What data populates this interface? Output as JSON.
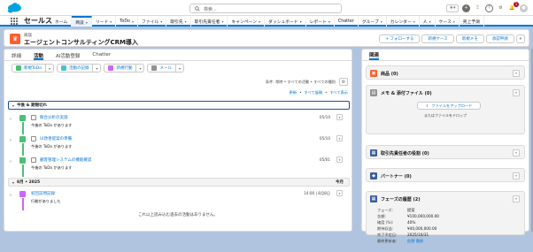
{
  "topbar": {
    "search_placeholder": "検索...",
    "notification_count": "1"
  },
  "nav": {
    "app_name": "セールス",
    "items": [
      {
        "label": "ホーム",
        "has_menu": false,
        "active": false
      },
      {
        "label": "商談",
        "has_menu": true,
        "active": true
      },
      {
        "label": "リード",
        "has_menu": true,
        "active": false
      },
      {
        "label": "ToDo",
        "has_menu": true,
        "active": false
      },
      {
        "label": "ファイル",
        "has_menu": true,
        "active": false
      },
      {
        "label": "取引先",
        "has_menu": true,
        "active": false
      },
      {
        "label": "取引先責任者",
        "has_menu": true,
        "active": false
      },
      {
        "label": "キャンペーン",
        "has_menu": true,
        "active": false
      },
      {
        "label": "ダッシュボード",
        "has_menu": true,
        "active": false
      },
      {
        "label": "レポート",
        "has_menu": true,
        "active": false
      },
      {
        "label": "Chatter",
        "has_menu": false,
        "active": false
      },
      {
        "label": "グループ",
        "has_menu": true,
        "active": false
      },
      {
        "label": "カレンダー",
        "has_menu": true,
        "active": false
      },
      {
        "label": "人",
        "has_menu": true,
        "active": false
      },
      {
        "label": "ケース",
        "has_menu": true,
        "active": false
      },
      {
        "label": "売上予測",
        "has_menu": false,
        "active": false
      }
    ]
  },
  "header": {
    "record_type": "商談",
    "title": "エージェントコンサルティングCRM導入",
    "buttons": [
      "+ フォローする",
      "新規ケース",
      "新規メモ",
      "承認申請"
    ]
  },
  "left": {
    "tabs": [
      "詳細",
      "活動",
      "AI活動登録",
      "Chatter"
    ],
    "active_tab": 1,
    "action_buttons": [
      {
        "label": "新規ToDo",
        "color": "#4bc076"
      },
      {
        "label": "活動の記録",
        "color": "#48c3cc"
      },
      {
        "label": "新規行動",
        "color": "#cb65ff"
      },
      {
        "label": "メール",
        "color": "#939393"
      }
    ],
    "filter_text": "条件: 常時 • すべての活動 • すべての種別",
    "links": [
      "更新",
      "•",
      "すべて展開",
      "•",
      "すべて表示"
    ],
    "section1": "今後 & 期限切れ",
    "tasks": [
      {
        "title": "競合分析の実施",
        "sub": "今後の ToDo があります",
        "date": "05/10"
      },
      {
        "title": "UI改善提案の準備",
        "sub": "今後の ToDo があります",
        "date": "05/10"
      },
      {
        "title": "顧客管理システムの機能確認",
        "sub": "今後の ToDo があります",
        "date": "05/01"
      }
    ],
    "section2": "8月 • 2025",
    "section2_right": "今月",
    "event": {
      "title": "初回訪問記録",
      "sub": "行動がありました",
      "date": "14:00 | 8月8日"
    },
    "no_more": "これ以上読み込む過去の活動はありません。",
    "colors": {
      "task": "#4bc076",
      "event": "#cb65ff",
      "selected_border": "#1b5297"
    }
  },
  "right": {
    "header": "関連",
    "cards": [
      {
        "title": "商品 (0)",
        "icon_color": "#ff5d2d"
      },
      {
        "title": "メモ & 添付ファイル (0)",
        "icon_color": "#939393",
        "upload": "ファイルをアップロード",
        "drop": "またはファイルをドロップ"
      },
      {
        "title": "取引先責任者の役割 (0)",
        "icon_color": "#3c5f9c"
      },
      {
        "title": "パートナー (0)",
        "icon_color": "#3c5f9c"
      },
      {
        "title": "フェーズの履歴 (2)",
        "icon_color": "#3c5f9c"
      }
    ],
    "stage_fields": [
      {
        "label": "フェーズ:",
        "value": "提案",
        "link": false
      },
      {
        "label": "金額:",
        "value": "¥100,000,000.00",
        "link": false
      },
      {
        "label": "確度 (%):",
        "value": "40%",
        "link": false
      },
      {
        "label": "期待収益:",
        "value": "¥40,000,000.00",
        "link": false
      },
      {
        "label": "完了予定日:",
        "value": "2025/10/31",
        "link": false
      },
      {
        "label": "最終更新者:",
        "value": "佐野 貴俊",
        "link": true
      },
      {
        "label": "最終更新日:",
        "value": "2025/08/...",
        "link": false
      }
    ]
  }
}
